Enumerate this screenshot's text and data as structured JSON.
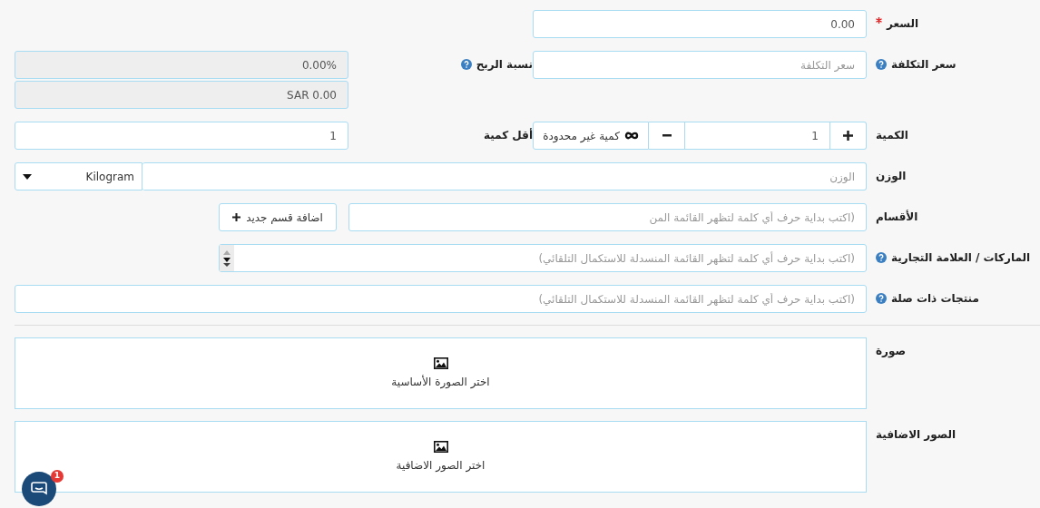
{
  "price": {
    "label": {
      "text": "السعر",
      "required": true,
      "help": false
    },
    "value": "0.00"
  },
  "cost_price": {
    "label": {
      "text": "سعر التكلفة",
      "required": false,
      "help": true
    },
    "placeholder": "سعر التكلفة"
  },
  "profit": {
    "label": {
      "text": "نسبة الربح",
      "required": false,
      "help": true
    },
    "percent": {
      "value": "0.00%",
      "disabled": true
    },
    "amount": {
      "value": "SAR 0.00",
      "disabled": true
    }
  },
  "quantity": {
    "label": {
      "text": "الكمية",
      "required": false,
      "help": false
    },
    "value": "1",
    "unlimited_button": "كمية غير محدودة"
  },
  "min_quantity": {
    "label": {
      "text": "أقل كمية",
      "required": false,
      "help": false
    },
    "value": "1"
  },
  "weight": {
    "label": {
      "text": "الوزن",
      "required": false,
      "help": false
    },
    "placeholder": "الوزن",
    "unit": "Kilogram"
  },
  "categories": {
    "label": {
      "text": "الأقسام",
      "required": false,
      "help": false
    },
    "placeholder": "(اكتب بداية حرف أي كلمة لتظهر القائمة المن",
    "add_button": "اضافة قسم جديد"
  },
  "brands": {
    "label": {
      "text": "الماركات / العلامة التجارية",
      "required": false,
      "help": true
    },
    "placeholder": "(اكتب بداية حرف أي كلمة لتظهر القائمة المنسدلة للاستكمال التلقائي)"
  },
  "related_products": {
    "label": {
      "text": "منتجات ذات صلة",
      "required": false,
      "help": true
    },
    "placeholder": "(اكتب بداية حرف أي كلمة لتظهر القائمة المنسدلة للاستكمال التلقائي)"
  },
  "main_image": {
    "label": {
      "text": "صورة",
      "required": false,
      "help": false
    },
    "button": "اختر الصورة الأساسية"
  },
  "extra_images": {
    "label": {
      "text": "الصور الاضافية",
      "required": false,
      "help": false
    },
    "button": "اختر الصور الاضافية"
  },
  "chat": {
    "badge": "1"
  }
}
